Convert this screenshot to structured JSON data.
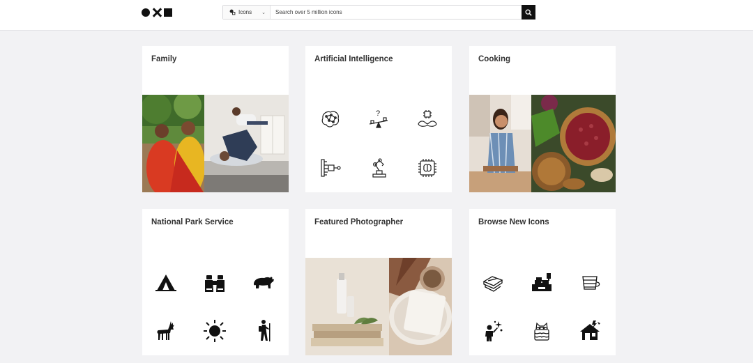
{
  "header": {
    "logo_icons": [
      "circle-icon",
      "x-icon",
      "square-icon"
    ],
    "search": {
      "type_label": "Icons",
      "placeholder": "Search over 5 million icons"
    }
  },
  "cards": {
    "family": {
      "title": "Family"
    },
    "ai": {
      "title": "Artificial Intelligence",
      "icons": [
        "brain-network-icon",
        "question-seesaw-icon",
        "chip-hands-icon",
        "neural-branch-icon",
        "robot-arm-icon",
        "brain-chip-icon"
      ]
    },
    "cooking": {
      "title": "Cooking"
    },
    "nps": {
      "title": "National Park Service",
      "icons": [
        "tent-icon",
        "binoculars-icon",
        "bear-icon",
        "deer-icon",
        "sun-icon",
        "hiker-icon"
      ]
    },
    "photographer": {
      "title": "Featured Photographer"
    },
    "new_icons": {
      "title": "Browse New Icons",
      "icons": [
        "book-hand-icon",
        "cash-register-icon",
        "cup-stack-icon",
        "person-sparkle-icon",
        "cat-cake-icon",
        "house-storm-icon"
      ]
    }
  },
  "colors": {
    "header_bg": "#ffffff",
    "page_bg": "#f2f2f4",
    "search_button": "#111111"
  }
}
